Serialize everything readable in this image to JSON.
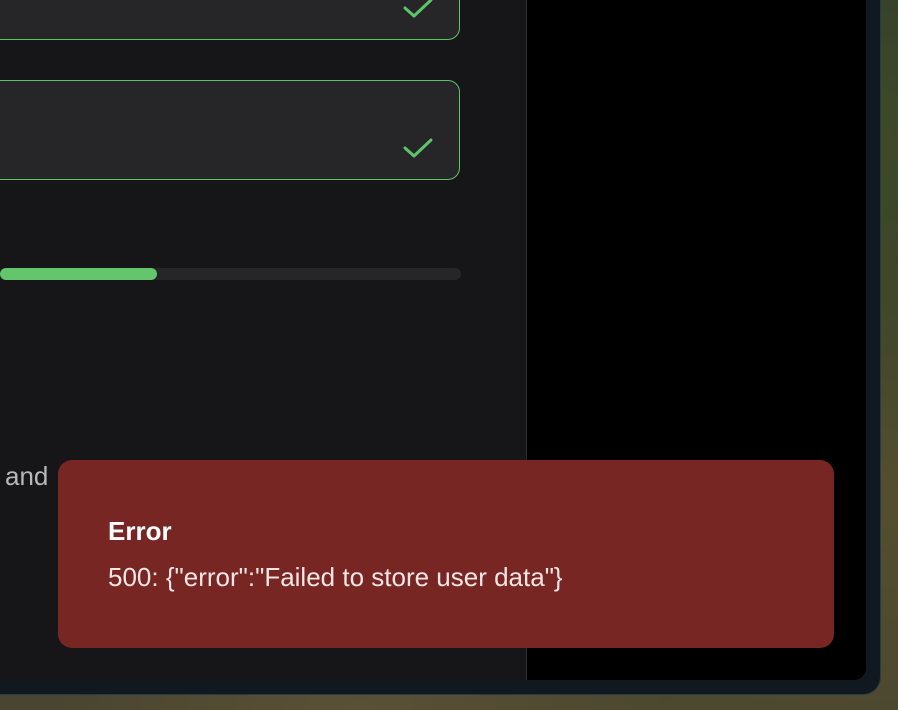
{
  "form": {
    "field_1": {
      "valid": true,
      "check_icon": "check-icon"
    },
    "field_2": {
      "valid": true,
      "check_icon": "check-icon"
    },
    "progress": {
      "fraction": 0.34
    },
    "partial_text": "and"
  },
  "toast": {
    "title": "Error",
    "message": "500: {\"error\":\"Failed to store user data\"}"
  },
  "colors": {
    "accent_green": "#5ec46a",
    "error_background": "#772623",
    "panel_background": "#161618"
  }
}
